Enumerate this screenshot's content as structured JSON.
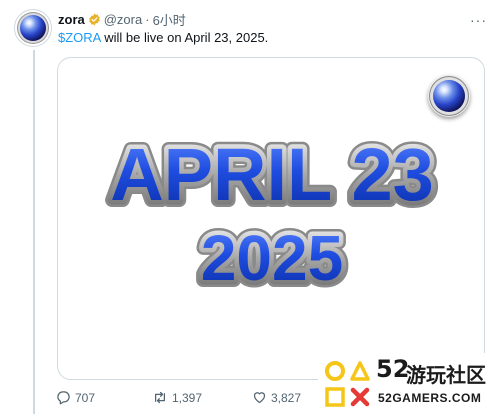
{
  "tweet": {
    "display_name": "zora",
    "handle": "@zora",
    "separator": "·",
    "time": "6小时",
    "cashtag": "$ZORA",
    "text": " will be live on April 23, 2025.",
    "more_label": "···"
  },
  "media": {
    "line1": "APRIL 23",
    "line2": "2025"
  },
  "actions": {
    "replies": "707",
    "reposts": "1,397",
    "likes": "3,827"
  },
  "watermark": {
    "number": "52",
    "site_name": "游玩社区",
    "domain": "52GAMERS.COM"
  },
  "colors": {
    "link": "#1d9bf0",
    "date_blue": "#1f4de0",
    "verified_gold": "#e8b32c",
    "watermark_yellow": "#f5c518",
    "watermark_red": "#e53935"
  }
}
